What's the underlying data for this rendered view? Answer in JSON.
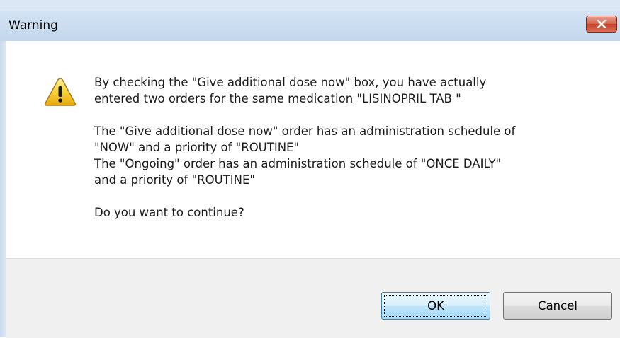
{
  "window": {
    "title": "Warning",
    "close_icon": "close-icon"
  },
  "dialog": {
    "icon": "warning-icon",
    "message": {
      "line1": "By checking the \"Give additional dose now\" box, you have actually",
      "line2": "entered two orders for the same medication \"LISINOPRIL TAB \"",
      "line3": "The \"Give additional dose now\" order has an administration schedule of",
      "line4": "\"NOW\" and a priority of \"ROUTINE\"",
      "line5": "The \"Ongoing\" order has an administration schedule of \"ONCE DAILY\"",
      "line6": "and a priority of \"ROUTINE\"",
      "line7": "Do you want to continue?"
    }
  },
  "buttons": {
    "ok_label": "OK",
    "cancel_label": "Cancel"
  },
  "colors": {
    "titlebar": "#c8dbf0",
    "close_button": "#c9452c",
    "footer": "#f0f0f0",
    "warning_yellow": "#f5c518"
  }
}
